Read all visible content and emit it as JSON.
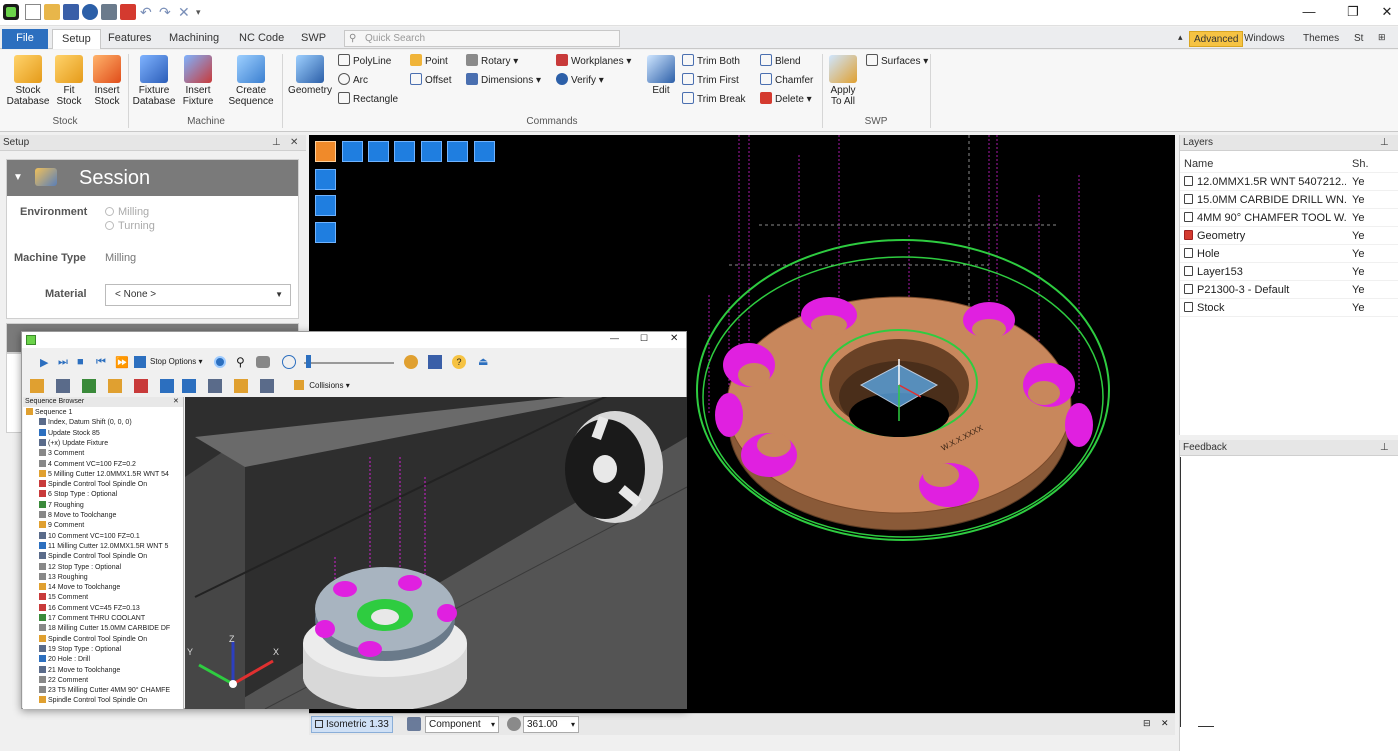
{
  "quick_access": [
    "app-logo-icon",
    "new-icon",
    "open-icon",
    "save-icon",
    "info-icon",
    "print-icon",
    "paint-icon",
    "undo-icon",
    "redo-icon",
    "close-doc-icon"
  ],
  "menu": {
    "tabs": [
      "File",
      "Setup",
      "Features",
      "Machining",
      "NC Code",
      "SWP"
    ],
    "active": "Setup",
    "quick_search_placeholder": "Quick Search",
    "right": [
      "Advanced",
      "Windows",
      "Themes",
      "St"
    ]
  },
  "ribbon": {
    "stock": {
      "group": "Stock",
      "buttons": [
        "Stock\nDatabase",
        "Fit\nStock",
        "Insert\nStock"
      ]
    },
    "machine": {
      "group": "Machine",
      "buttons": [
        "Fixture\nDatabase",
        "Insert\nFixture",
        "Create\nSequence"
      ]
    },
    "commands": {
      "group": "Commands",
      "geometry": "Geometry",
      "col1": [
        "PolyLine",
        "Arc",
        "Rectangle"
      ],
      "col2": [
        "Point",
        "Offset"
      ],
      "col3": [
        "Rotary",
        "Dimensions"
      ],
      "col4": [
        "Workplanes",
        "Verify"
      ],
      "edit": "Edit",
      "col5": [
        "Trim Both",
        "Trim First",
        "Trim Break"
      ],
      "col6": [
        "Blend",
        "Chamfer",
        "Delete"
      ]
    },
    "swp": {
      "group": "SWP",
      "apply": "Apply\nTo All",
      "surfaces": "Surfaces"
    }
  },
  "setup_panel": {
    "title": "Setup",
    "session_title": "Session",
    "environment_label": "Environment",
    "environment_options": [
      "Milling",
      "Turning"
    ],
    "machine_type_label": "Machine Type",
    "machine_type_value": "Milling",
    "material_label": "Material",
    "material_value": "< None >"
  },
  "layers_panel": {
    "title": "Layers",
    "col_name": "Name",
    "col_show": "Sh.",
    "rows": [
      {
        "name": "12.0MMX1.5R WNT 5407212...",
        "show": "Ye",
        "icon": "tool-icon"
      },
      {
        "name": "15.0MM CARBIDE DRILL WN...",
        "show": "Ye",
        "icon": "tool-icon"
      },
      {
        "name": "4MM 90° CHAMFER TOOL W...",
        "show": "Ye",
        "icon": "tool-icon"
      },
      {
        "name": "Geometry",
        "show": "Ye",
        "icon": "geometry-icon"
      },
      {
        "name": "Hole",
        "show": "Ye",
        "icon": "tool-icon"
      },
      {
        "name": "Layer153",
        "show": "Ye",
        "icon": "tool-icon"
      },
      {
        "name": "P21300-3 - Default",
        "show": "Ye",
        "icon": "tool-icon"
      },
      {
        "name": "Stock",
        "show": "Ye",
        "icon": "tool-icon"
      }
    ]
  },
  "feedback_panel": {
    "title": "Feedback"
  },
  "viewport_status": {
    "view": "Isometric 1.33",
    "mode": "Component",
    "value": "361.00"
  },
  "sim_window": {
    "stop_options": "Stop Options",
    "collisions": "Collisions",
    "browser_title": "Sequence Browser",
    "sequence": [
      "Sequence 1",
      "Index, Datum Shift (0, 0, 0)",
      "Update Stock 85",
      "(+x) Update Fixture",
      "3 Comment",
      "4 Comment  VC=100 FZ=0.2",
      "5 Milling Cutter  12.0MMX1.5R WNT 54",
      "Spindle Control Tool Spindle On",
      "6 Stop Type : Optional",
      "7 Roughing",
      "8 Move to Toolchange",
      "9 Comment",
      "10 Comment  VC=100 FZ=0.1",
      "11 Milling Cutter  12.0MMX1.5R WNT 5",
      "Spindle Control Tool Spindle On",
      "12 Stop Type : Optional",
      "13 Roughing",
      "14 Move to Toolchange",
      "15 Comment",
      "16 Comment  VC=45 FZ=0.13",
      "17 Comment  THRU COOLANT",
      "18 Milling Cutter  15.0MM CARBIDE DF",
      "Spindle Control Tool Spindle On",
      "19 Stop Type : Optional",
      "20 Hole : Drill",
      "21 Move to Toolchange",
      "22 Comment",
      "23 T5 Milling Cutter  4MM 90° CHAMFE",
      "Spindle Control Tool Spindle On"
    ],
    "axis_z": "Z",
    "axis_x": "X",
    "axis_y": "Y"
  },
  "colors": {
    "file_tab": "#2c6fbf",
    "advanced_badge": "#f6c343",
    "viewport_bg": "#000000",
    "part_copper": "#c8875c",
    "toolpath_magenta": "#e020e0",
    "stock_green": "#2ecc40"
  }
}
